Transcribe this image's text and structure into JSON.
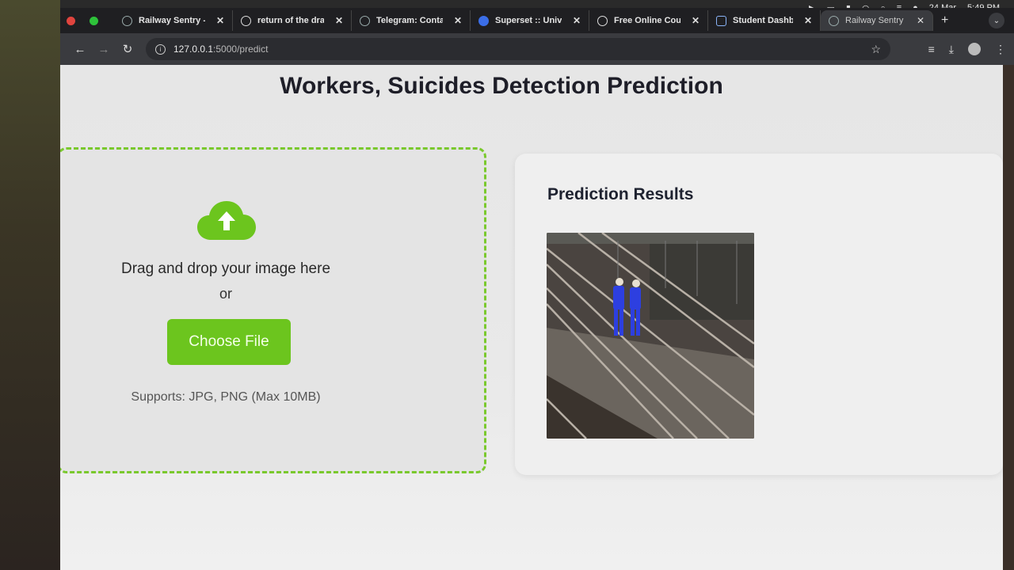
{
  "system": {
    "date": "24 Mar",
    "time": "5:49 PM"
  },
  "browser": {
    "tabs": [
      {
        "title": "Railway Sentry - Pr",
        "icon": "globe-icon"
      },
      {
        "title": "return of the drago",
        "icon": "google-icon"
      },
      {
        "title": "Telegram: Contact",
        "icon": "globe-icon"
      },
      {
        "title": "Superset :: Univers",
        "icon": "superset-icon"
      },
      {
        "title": "Free Online Course",
        "icon": "google-icon"
      },
      {
        "title": "Student Dashboard",
        "icon": "page-icon"
      },
      {
        "title": "Railway Sentry - Pr",
        "icon": "globe-icon",
        "active": true
      }
    ],
    "url_host": "127.0.0.1",
    "url_path": ":5000/predict"
  },
  "page": {
    "title": "Workers, Suicides Detection Prediction",
    "upload": {
      "drag_text": "Drag and drop your image here",
      "or_text": "or",
      "button_label": "Choose File",
      "supports_text": "Supports: JPG, PNG (Max 10MB)"
    },
    "results": {
      "title": "Prediction Results",
      "image_alt": "railway workers on tracks"
    }
  },
  "colors": {
    "accent_green": "#6cc51e",
    "dashed_border": "#7ac92d"
  }
}
